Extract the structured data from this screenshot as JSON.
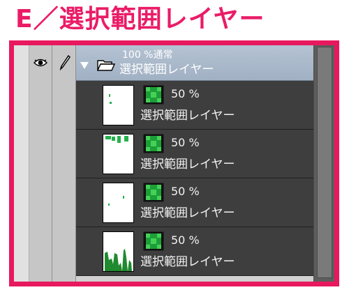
{
  "header": {
    "title": "E／選択範囲レイヤー"
  },
  "colors": {
    "accent": "#e8185f",
    "mask_green": "#22b14c",
    "folder_blue": "#a9b8cb"
  },
  "panel": {
    "columns": [
      {
        "icon": "eye-icon"
      },
      {
        "icon": "pen-icon"
      }
    ],
    "folder": {
      "mode": "100 %通常",
      "name": "選択範囲レイヤー",
      "expand_icon": "triangle-down-icon",
      "icon": "folder-open-icon"
    },
    "layers": [
      {
        "opacity": "50 %",
        "name": "選択範囲レイヤー",
        "mask_icon": "selection-mask-icon"
      },
      {
        "opacity": "50 %",
        "name": "選択範囲レイヤー",
        "mask_icon": "selection-mask-icon"
      },
      {
        "opacity": "50 %",
        "name": "選択範囲レイヤー",
        "mask_icon": "selection-mask-icon"
      },
      {
        "opacity": "50 %",
        "name": "選択範囲レイヤー",
        "mask_icon": "selection-mask-icon"
      }
    ]
  }
}
